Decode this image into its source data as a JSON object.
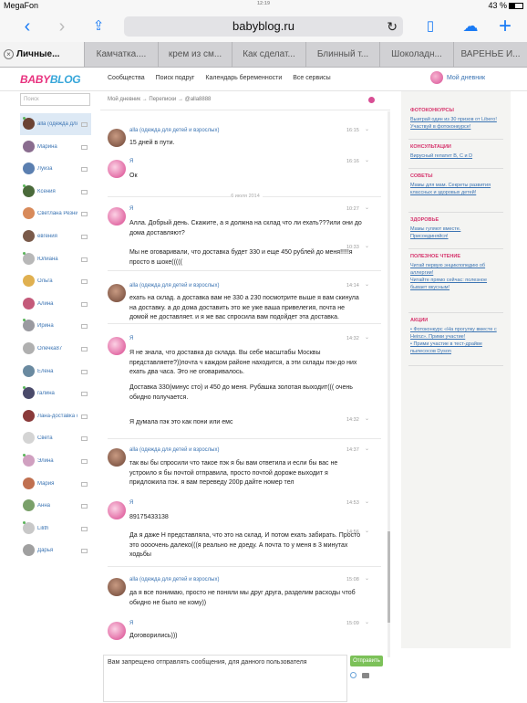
{
  "status": {
    "carrier": "MegaFon",
    "time": "12:19",
    "battery": "43 %"
  },
  "browser": {
    "url": "babyblog.ru",
    "tabs": [
      "Личные...",
      "Камчатка....",
      "крем из см...",
      "Как сделат...",
      "Блинный т...",
      "Шоколадн...",
      "ВАРЕНЬЕ И..."
    ]
  },
  "site": {
    "logo_left": "BABY",
    "logo_right": "BLOG",
    "nav": [
      "Сообщества",
      "Поиск подруг",
      "Календарь беременности",
      "Все сервисы"
    ],
    "my_diary": "Мой дневник"
  },
  "sidebar": {
    "search_placeholder": "Поиск",
    "contacts": [
      {
        "name": "alla (одежда для детей и взрослых)",
        "avatar": "#6b4334"
      },
      {
        "name": "Марина",
        "avatar": "#8a6d8f"
      },
      {
        "name": "Луиза",
        "avatar": "#5b7fb0"
      },
      {
        "name": "Ксения",
        "avatar": "#4a6a3a"
      },
      {
        "name": "Светлана Резник",
        "avatar": "#d88a5a"
      },
      {
        "name": "евгения",
        "avatar": "#7a5a4a"
      },
      {
        "name": "Юлиана",
        "avatar": "#b8b8b8"
      },
      {
        "name": "Ольга",
        "avatar": "#e0b050"
      },
      {
        "name": "Алина",
        "avatar": "#c45a7a"
      },
      {
        "name": "Ирина",
        "avatar": "#9a9aa0"
      },
      {
        "name": "Олечка87",
        "avatar": "#b0b0b0"
      },
      {
        "name": "Елена",
        "avatar": "#6a8aa0"
      },
      {
        "name": "галина",
        "avatar": "#4a4a6a"
      },
      {
        "name": "Лана-доставка одежды",
        "avatar": "#8a3a3a"
      },
      {
        "name": "Света",
        "avatar": "#d4d4d4"
      },
      {
        "name": "Элина",
        "avatar": "#d0a0c0"
      },
      {
        "name": "Мария",
        "avatar": "#c07050"
      },
      {
        "name": "Анна",
        "avatar": "#7aa06a"
      },
      {
        "name": "Lilith",
        "avatar": "#c8c8c8"
      },
      {
        "name": "Дарья",
        "avatar": "#a0a0a0"
      }
    ]
  },
  "conversation": {
    "breadcrumbs": "Мой дневник → Переписки → @alla8888",
    "date_separator": "6 июля 2014",
    "messages": [
      {
        "sender": "alla (одежда для детей и взрослых)",
        "who": "alla",
        "time": "16:15",
        "text": "15 дней в пути."
      },
      {
        "sender": "Я",
        "who": "me",
        "time": "16:16",
        "text": "Ок"
      },
      {
        "sender": "Я",
        "who": "me",
        "time": "10:27",
        "text": "Алла. Добрый день. Скажите, а я должна на склад что ли ехать???или они до дома доставляют?"
      },
      {
        "sender": "",
        "who": "me",
        "time": "10:33",
        "text": "Мы не оговаривали, что доставка будет 330 и еще 450 рублей до меня!!!!!я просто в шоке((((("
      },
      {
        "sender": "alla (одежда для детей и взрослых)",
        "who": "alla",
        "time": "14:14",
        "text": "ехать на склад. а доставка вам не 330 а 230 посмотрите выше я вам скинула на доставку. а до дома доставить это же уже ваша привелегия, почта не домой не доставляет. и я же вас спросила вам подойдет эта доставка."
      },
      {
        "sender": "Я",
        "who": "me",
        "time": "14:32",
        "text": "Я не знала, что доставка до склада. Вы себе масштабы Москвы представляете?))почта ч каждом районе находится, а эти склады пэк-до них ехать два часа. Это не оговаривалось."
      },
      {
        "sender": "",
        "who": "me",
        "time": "",
        "text": "Доставка 330(минус сто) и 450 до меня. Рубашка золотая выходит((( очень обидно получается."
      },
      {
        "sender": "",
        "who": "me",
        "time": "14:32",
        "text": "Я думала пэк это как пони или емс"
      },
      {
        "sender": "alla (одежда для детей и взрослых)",
        "who": "alla",
        "time": "14:37",
        "text": "так вы бы спросили что такое пэк я бы вам ответила и если бы вас не устроило я бы почтой отправила, просто почтой дороже выходит я придложила пэк. я вам переведу 200р дайте номер тел"
      },
      {
        "sender": "Я",
        "who": "me",
        "time": "14:53",
        "text": "89175433138"
      },
      {
        "sender": "",
        "who": "me",
        "time": "14:56",
        "text": "Да я даже Н представляла, что это на склад. И потом ехать забирать. Просто это оооочень далеко(((я реально не доеду. А почта то у меня в 3 минутах ходьбы"
      },
      {
        "sender": "alla (одежда для детей и взрослых)",
        "who": "alla",
        "time": "15:08",
        "text": "да я все понимаю, просто не поняли мы друг друга, разделим расходы чтоб обидно не было не кому))"
      },
      {
        "sender": "Я",
        "who": "me",
        "time": "15:09",
        "text": "Договорились)))"
      }
    ],
    "compose_text": "Вам запрещено отправлять сообщения, для данного пользователя",
    "send_label": "Отправить"
  },
  "right_sidebar": {
    "blocks": [
      {
        "title": "ФОТОКОНКУРСЫ",
        "links": [
          "Выиграй один из 30 призов от Libero! Участвуй в фотоконкурсе!"
        ]
      },
      {
        "title": "КОНСУЛЬТАЦИИ",
        "links": [
          "Вирусный гепатит В, С и D"
        ]
      },
      {
        "title": "СОВЕТЫ",
        "links": [
          "Мамы для мам. Секреты развития классных и здоровых детей!"
        ]
      },
      {
        "title": "ЗДОРОВЬЕ",
        "links": [
          "Мамы гуляют вместе. Присоединяйся!"
        ]
      },
      {
        "title": "ПОЛЕЗНОЕ ЧТЕНИЕ",
        "links": [
          "Читай первую энциклопедию об аллергии!",
          "Читайте прямо сейчас: полезное бывает вкусным!"
        ]
      },
      {
        "title": "АКЦИИ",
        "links": [
          "• Фотоконкурс «На прогулку вместе с Heinz». Прими участие!",
          "• Прими участие в тест-драйве пылесосов Dyson"
        ]
      }
    ]
  }
}
